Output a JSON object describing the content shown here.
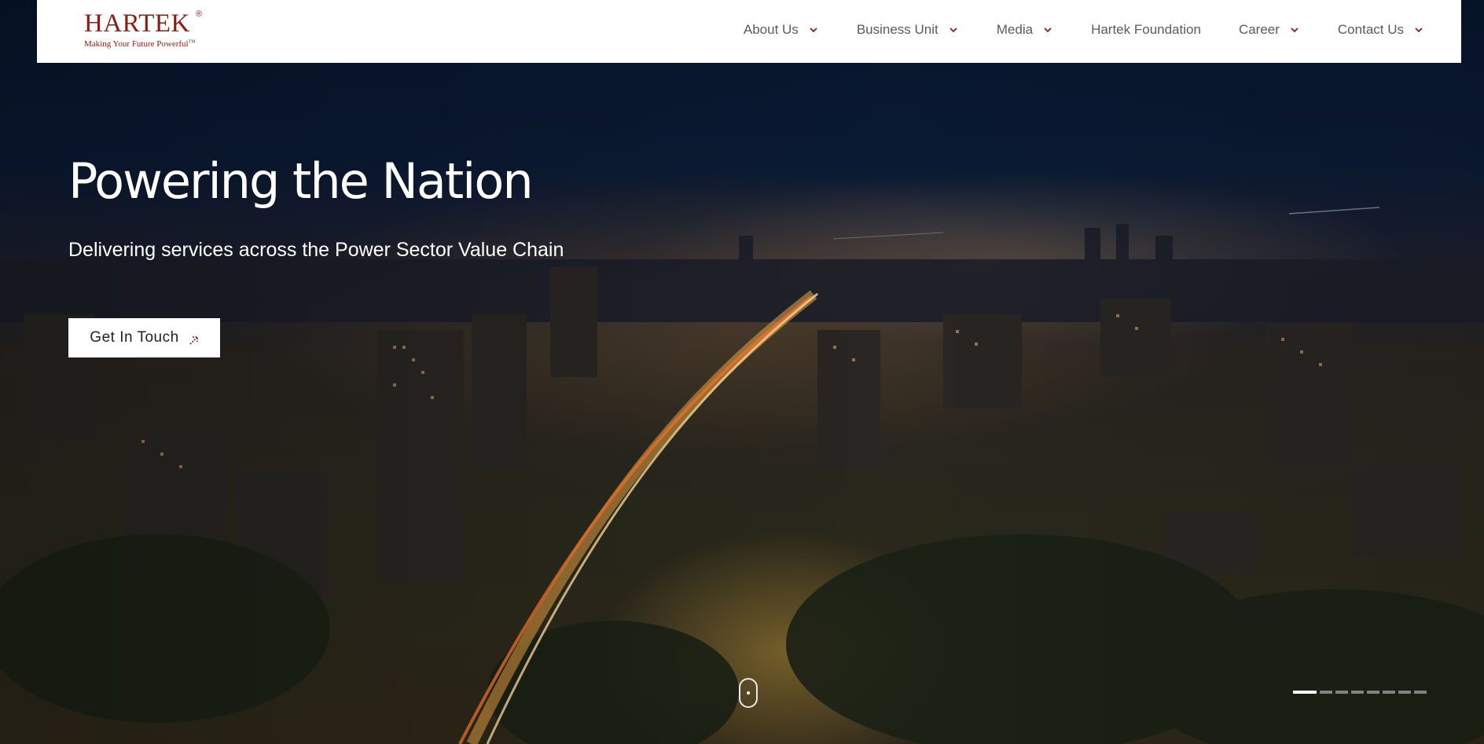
{
  "brand": {
    "name": "HARTEK",
    "registered_mark": "®",
    "tagline": "Making Your Future Powerful",
    "trademark": "TM",
    "color": "#8a1c14"
  },
  "nav": {
    "items": [
      {
        "label": "About Us",
        "has_dropdown": true,
        "icon": "chevron-down-icon"
      },
      {
        "label": "Business Unit",
        "has_dropdown": true,
        "icon": "chevron-down-icon"
      },
      {
        "label": "Media",
        "has_dropdown": true,
        "icon": "chevron-down-icon"
      },
      {
        "label": "Hartek Foundation",
        "has_dropdown": false
      },
      {
        "label": "Career",
        "has_dropdown": true,
        "icon": "chevron-down-icon"
      },
      {
        "label": "Contact Us",
        "has_dropdown": true,
        "icon": "chevron-down-icon"
      }
    ]
  },
  "hero": {
    "title": "Powering the Nation",
    "subtitle": "Delivering services across the Power Sector Value Chain",
    "cta_label": "Get In Touch",
    "cta_icon": "arrow-up-right-icon",
    "background": "night-city-aerial-image"
  },
  "scroll_indicator": {
    "icon": "mouse-scroll-icon"
  },
  "slider": {
    "total_slides": 8,
    "active_index": 0
  }
}
